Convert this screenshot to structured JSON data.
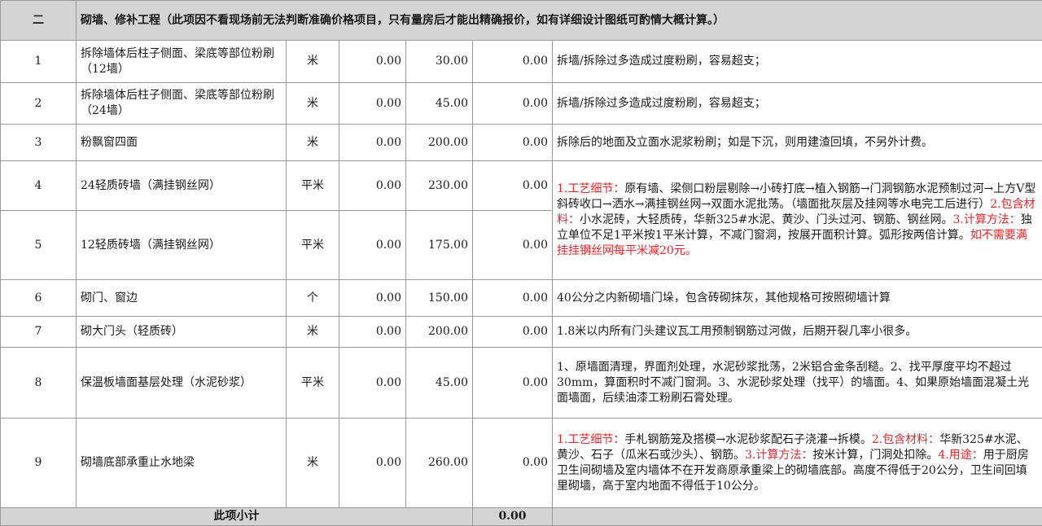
{
  "section": {
    "number": "二",
    "title": "砌墙、修补工程（此项因不看现场前无法判断准确价格项目，只有量房后才能出精确报价，如有详细设计图纸可酌情大概计算。）"
  },
  "rows": [
    {
      "no": "1",
      "name": "拆除墙体后柱子侧面、梁底等部位粉刷（12墙）",
      "unit": "米",
      "qty": "0.00",
      "price": "30.00",
      "total": "0.00",
      "desc": "拆墙/拆除过多造成过度粉刷，容易超支；"
    },
    {
      "no": "2",
      "name": "拆除墙体后柱子侧面、梁底等部位粉刷（24墙）",
      "unit": "米",
      "qty": "0.00",
      "price": "45.00",
      "total": "0.00",
      "desc": "拆墙/拆除过多造成过度粉刷，容易超支；"
    },
    {
      "no": "3",
      "name": "粉飘窗四面",
      "unit": "米",
      "qty": "0.00",
      "price": "200.00",
      "total": "0.00",
      "desc": "拆除后的地面及立面水泥浆粉刷；如是下沉，则用建渣回填，不另外计费。"
    },
    {
      "no": "4",
      "name": "24轻质砖墙（满挂钢丝网）",
      "unit": "平米",
      "qty": "0.00",
      "price": "230.00",
      "total": "0.00"
    },
    {
      "no": "5",
      "name": "12轻质砖墙（满挂钢丝网）",
      "unit": "平米",
      "qty": "0.00",
      "price": "175.00",
      "total": "0.00"
    },
    {
      "no": "6",
      "name": "砌门、窗边",
      "unit": "个",
      "qty": "0.00",
      "price": "150.00",
      "total": "0.00",
      "desc": "40公分之内新砌墙门垛，包含砖砌抹灰，其他规格可按照砌墙计算"
    },
    {
      "no": "7",
      "name": "砌大门头（轻质砖）",
      "unit": "米",
      "qty": "0.00",
      "price": "200.00",
      "total": "0.00",
      "desc": "1.8米以内所有门头建议瓦工用预制钢筋过河做，后期开裂几率小很多。"
    },
    {
      "no": "8",
      "name": "保温板墙面基层处理（水泥砂浆）",
      "unit": "平米",
      "qty": "0.00",
      "price": "45.00",
      "total": "0.00",
      "desc": "1、原墙面清理，界面剂处理，水泥砂浆批荡，2米铝合金条刮糙。2、找平厚度平均不超过30mm，算面积时不减门窗洞。3、水泥砂浆处理（找平）的墙面。4、如果原始墙面混凝土光面墙面，后续油漆工粉刷石膏处理。"
    },
    {
      "no": "9",
      "name": "砌墙底部承重止水地梁",
      "unit": "米",
      "qty": "0.00",
      "price": "260.00",
      "total": "0.00"
    }
  ],
  "merged_desc_45": {
    "p1_label": "1.工艺细节：",
    "p1_text": "原有墙、梁侧口粉层剔除→小砖打底→植入钢筋→门洞钢筋水泥预制过河→上方V型斜砖收口→洒水→满挂钢丝网→双面水泥批荡。（墙面批灰层及挂网等水电完工后进行）",
    "p2_label": "2.包含材料：",
    "p2_text": "小水泥砖，大轻质砖，华新325#水泥、黄沙、门头过河、钢筋、钢丝网。",
    "p3_label": "3.计算方法：",
    "p3_text": "独立单位不足1平米按1平米计算，不减门窗洞，按展开面积计算。弧形按两倍计算。",
    "p4_red": "如不需要满挂挂钢丝网每平米减20元。"
  },
  "desc_9": {
    "p1_label": "1.工艺细节：",
    "p1_text": "手札钢筋笼及搭模→水泥砂浆配石子浇灌→拆模。",
    "p2_label": "2.包含材料：",
    "p2_text": "华新325#水泥、黄沙、石子（瓜米石或沙头）、钢筋。",
    "p3_label": "3.计算方法：",
    "p3_text": "按米计算，门洞处扣除。",
    "p4_label": "4.用途：",
    "p4_text": "用于厨房卫生间砌墙及室内墙体不在开发商原承重梁上的砌墙底部。高度不得低于20公分，卫生间回填里砌墙，高于室内地面不得低于10公分。"
  },
  "subtotal": {
    "label": "此项小计",
    "value": "0.00"
  },
  "colors": {
    "header_bg": "#d4d4d4",
    "grid": "#9a9a9a",
    "red_text": "#e0262a"
  }
}
